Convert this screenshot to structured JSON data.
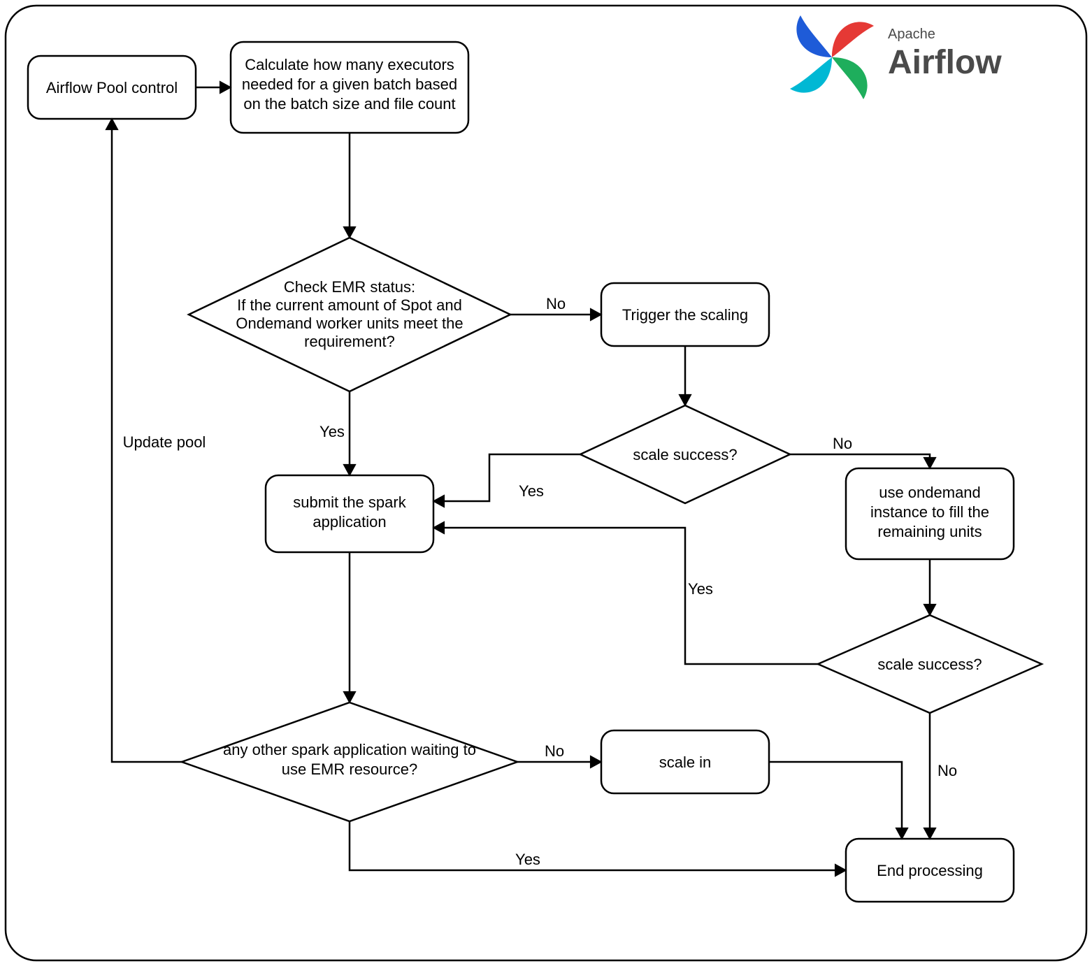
{
  "brand": {
    "super": "Apache",
    "name": "Airflow"
  },
  "nodes": {
    "pool": {
      "label": "Airflow Pool control"
    },
    "calc": {
      "l1": "Calculate how many executors",
      "l2": "needed for a given batch based",
      "l3": "on the batch size and file count"
    },
    "check": {
      "l1": "Check EMR status:",
      "l2": "If the current amount of Spot and",
      "l3": "Ondemand worker units meet the",
      "l4": "requirement?"
    },
    "trigger": {
      "label": "Trigger the scaling"
    },
    "scale1": {
      "label": "scale success?"
    },
    "submit": {
      "l1": "submit the spark",
      "l2": "application"
    },
    "ondemand": {
      "l1": "use ondemand",
      "l2": "instance to fill the",
      "l3": "remaining units"
    },
    "scale2": {
      "label": "scale success?"
    },
    "anyother": {
      "l1": "any other spark application waiting to",
      "l2": "use EMR resource?"
    },
    "scalein": {
      "label": "scale in"
    },
    "end": {
      "label": "End processing"
    }
  },
  "edges": {
    "yes": "Yes",
    "no": "No",
    "update": "Update pool"
  }
}
